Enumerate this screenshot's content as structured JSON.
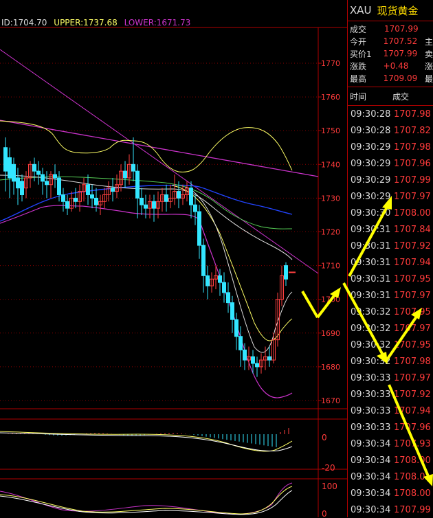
{
  "indicator": {
    "mid": "ID:1704.70",
    "upper": "UPPER:1737.68",
    "lower": "LOWER:1671.73"
  },
  "colors": {
    "up": "#ff4040",
    "down": "#33e6ff",
    "upper": "#ffff66",
    "lower": "#cc33cc",
    "axis": "#b00000",
    "arrow": "#ffff00"
  },
  "chart_data": {
    "type": "candlestick",
    "price_axis": {
      "ticks": [
        1770,
        1760,
        1750,
        1740,
        1730,
        1720,
        1710,
        1700,
        1690,
        1680,
        1670
      ],
      "range": [
        1666,
        1779
      ]
    },
    "macd_axis": {
      "ticks": [
        "0",
        "-20"
      ]
    },
    "kdj_axis": {
      "ticks": [
        "100",
        "0"
      ]
    }
  },
  "side": {
    "symbol": "XAU",
    "name": "现货黄金",
    "quote": [
      {
        "label": "成交",
        "value": "1707.99",
        "more": ""
      },
      {
        "label": "今开",
        "value": "1707.52",
        "more": "主"
      },
      {
        "label": "买价1",
        "value": "1707.99",
        "more": "卖"
      },
      {
        "label": "涨跌",
        "value": "+0.48",
        "more": "涨"
      },
      {
        "label": "最高",
        "value": "1709.09",
        "more": "最"
      }
    ],
    "ticks_header": {
      "time": "时间",
      "price": "成交"
    },
    "ticks": [
      {
        "time": "09:30:28",
        "price": "1707.98"
      },
      {
        "time": "09:30:28",
        "price": "1707.82"
      },
      {
        "time": "09:30:29",
        "price": "1707.98"
      },
      {
        "time": "09:30:29",
        "price": "1707.96"
      },
      {
        "time": "09:30:29",
        "price": "1707.99"
      },
      {
        "time": "09:30:29",
        "price": "1707.97"
      },
      {
        "time": "09:30:30",
        "price": "1708.00"
      },
      {
        "time": "09:30:31",
        "price": "1707.84"
      },
      {
        "time": "09:30:31",
        "price": "1707.92"
      },
      {
        "time": "09:30:31",
        "price": "1707.94"
      },
      {
        "time": "09:30:31",
        "price": "1707.95"
      },
      {
        "time": "09:30:31",
        "price": "1707.97"
      },
      {
        "time": "09:30:32",
        "price": "1707.95"
      },
      {
        "time": "09:30:32",
        "price": "1707.97"
      },
      {
        "time": "09:30:32",
        "price": "1707.95"
      },
      {
        "time": "09:30:32",
        "price": "1707.98"
      },
      {
        "time": "09:30:33",
        "price": "1707.97"
      },
      {
        "time": "09:30:33",
        "price": "1707.92"
      },
      {
        "time": "09:30:33",
        "price": "1707.94"
      },
      {
        "time": "09:30:33",
        "price": "1707.96"
      },
      {
        "time": "09:30:34",
        "price": "1707.93"
      },
      {
        "time": "09:30:34",
        "price": "1708.00"
      },
      {
        "time": "09:30:34",
        "price": "1708.01"
      },
      {
        "time": "09:30:34",
        "price": "1708.00"
      },
      {
        "time": "09:30:34",
        "price": "1707.99"
      }
    ]
  }
}
